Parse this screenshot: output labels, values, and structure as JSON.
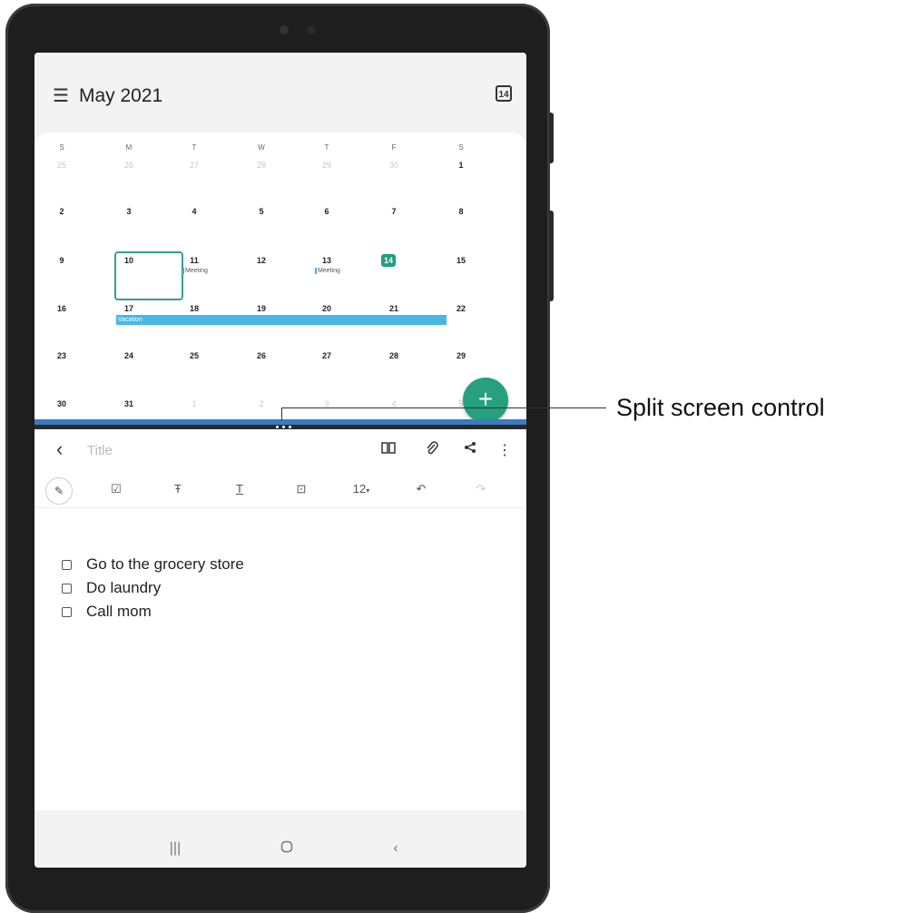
{
  "calendar": {
    "month_title": "May 2021",
    "today_icon_label": "14",
    "weekdays": [
      "S",
      "M",
      "T",
      "W",
      "T",
      "F",
      "S"
    ],
    "weeks": [
      [
        "25",
        "26",
        "27",
        "28",
        "29",
        "30",
        "1"
      ],
      [
        "2",
        "3",
        "4",
        "5",
        "6",
        "7",
        "8"
      ],
      [
        "9",
        "10",
        "11",
        "12",
        "13",
        "14",
        "15"
      ],
      [
        "16",
        "17",
        "18",
        "19",
        "20",
        "21",
        "22"
      ],
      [
        "23",
        "24",
        "25",
        "26",
        "27",
        "28",
        "29"
      ],
      [
        "30",
        "31",
        "1",
        "2",
        "3",
        "4",
        "5"
      ]
    ],
    "events": {
      "meeting_11": "Meeting",
      "meeting_13": "Meeting",
      "vacation": "Vacation"
    },
    "fab_label": "+",
    "accent": "#1fa07f"
  },
  "notes": {
    "title_placeholder": "Title",
    "font_size": "12",
    "items": [
      "Go to the grocery store",
      "Do laundry",
      "Call mom"
    ]
  },
  "callout": {
    "label": "Split screen control"
  },
  "colors": {
    "split_bar": "#3b7bbf",
    "vacation": "#49b7e6"
  }
}
